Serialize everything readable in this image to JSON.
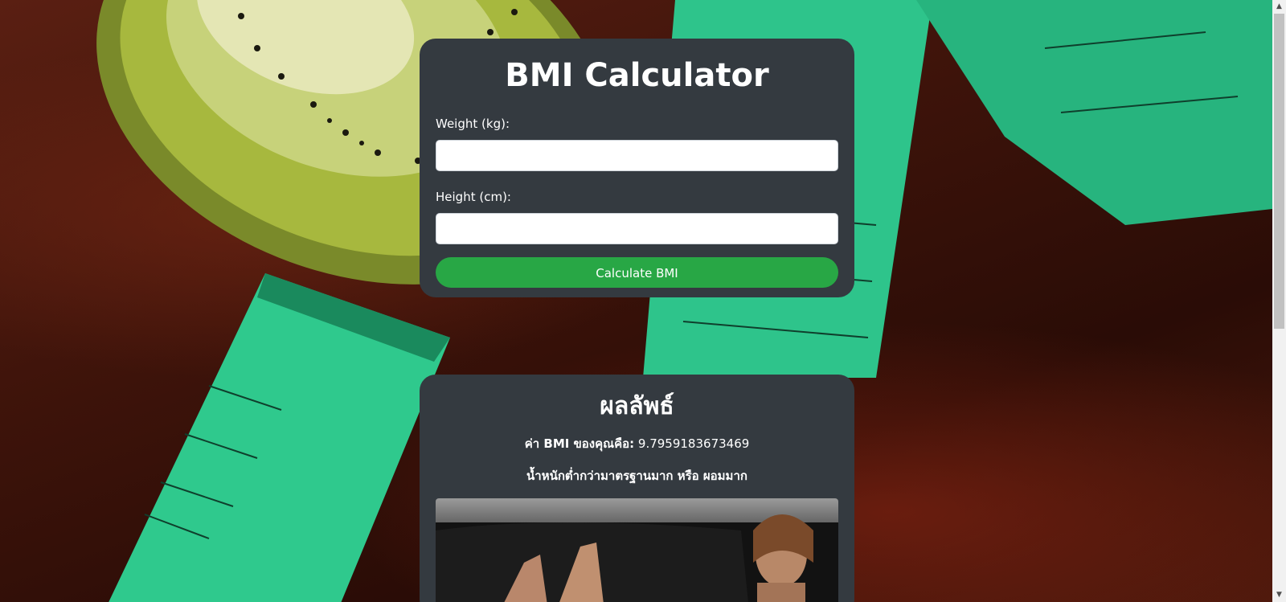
{
  "form": {
    "title": "BMI Calculator",
    "weight_label": "Weight (kg):",
    "weight_value": "",
    "height_label": "Height (cm):",
    "height_value": "",
    "submit_label": "Calculate BMI"
  },
  "result": {
    "title": "ผลลัพธ์",
    "bmi_prefix": "ค่า BMI ของคุณคือ:",
    "bmi_value": "9.7959183673469",
    "status": "น้ำหนักต่ำกว่ามาตรฐานมาก หรือ ผอมมาก"
  },
  "icons": {
    "scroll_up": "scroll-up-arrow-icon",
    "scroll_down": "scroll-down-arrow-icon"
  },
  "colors": {
    "card_bg": "#343a40",
    "button_bg": "#28a745",
    "text": "#ffffff"
  }
}
